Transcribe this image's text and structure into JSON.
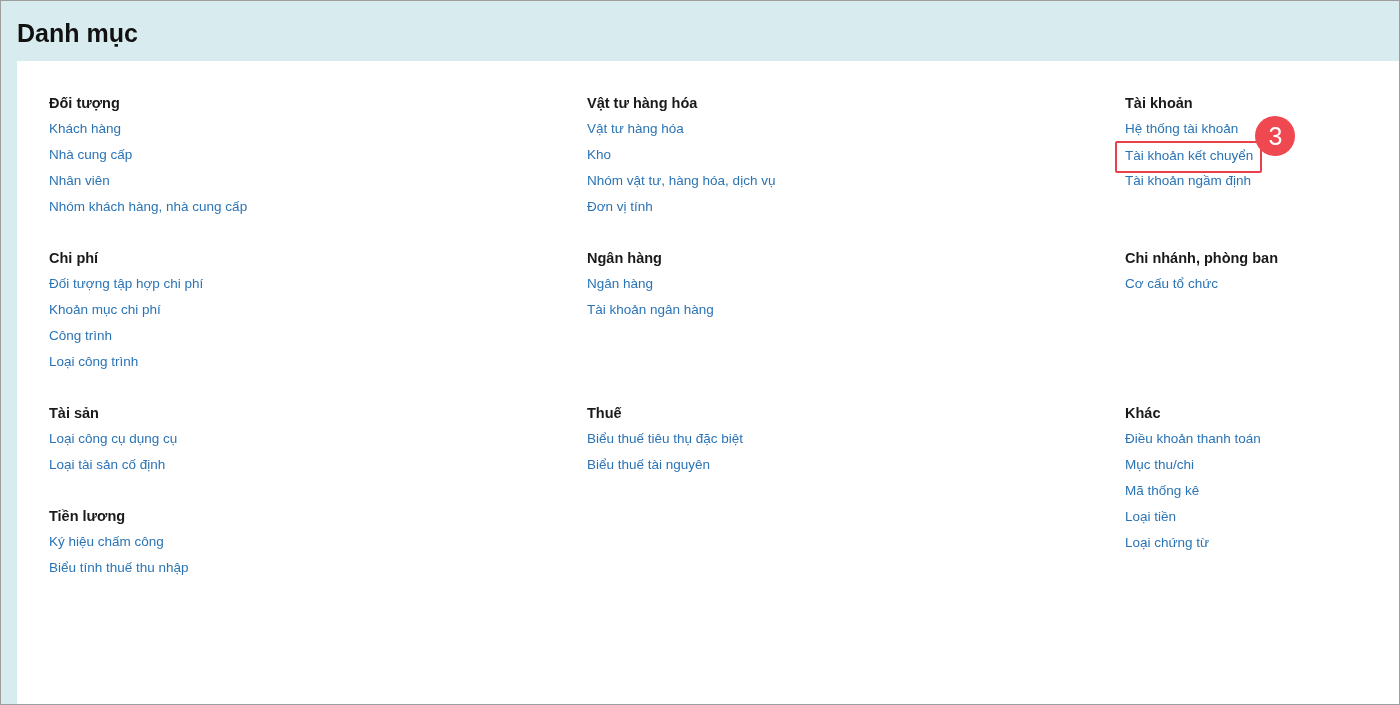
{
  "page": {
    "title": "Danh mục"
  },
  "rows": [
    {
      "columns": [
        [
          {
            "heading": "Đối tượng",
            "links": [
              {
                "label": "Khách hàng"
              },
              {
                "label": "Nhà cung cấp"
              },
              {
                "label": "Nhân viên"
              },
              {
                "label": "Nhóm khách hàng, nhà cung cấp"
              }
            ]
          }
        ],
        [
          {
            "heading": "Vật tư hàng hóa",
            "links": [
              {
                "label": "Vật tư hàng hóa"
              },
              {
                "label": "Kho"
              },
              {
                "label": "Nhóm vật tư, hàng hóa, dịch vụ"
              },
              {
                "label": "Đơn vị tính"
              }
            ]
          }
        ],
        [
          {
            "heading": "Tài khoản",
            "links": [
              {
                "label": "Hệ thống tài khoản"
              },
              {
                "label": "Tài khoản kết chuyển",
                "callout": "3"
              },
              {
                "label": "Tài khoản ngầm định"
              }
            ]
          }
        ]
      ]
    },
    {
      "columns": [
        [
          {
            "heading": "Chi phí",
            "links": [
              {
                "label": "Đối tượng tập hợp chi phí"
              },
              {
                "label": "Khoản mục chi phí"
              },
              {
                "label": "Công trình"
              },
              {
                "label": "Loại công trình"
              }
            ]
          }
        ],
        [
          {
            "heading": "Ngân hàng",
            "links": [
              {
                "label": "Ngân hàng"
              },
              {
                "label": "Tài khoản ngân hàng"
              }
            ]
          }
        ],
        [
          {
            "heading": "Chi nhánh, phòng ban",
            "links": [
              {
                "label": "Cơ cấu tổ chức"
              }
            ]
          }
        ]
      ]
    },
    {
      "columns": [
        [
          {
            "heading": "Tài sản",
            "links": [
              {
                "label": "Loại công cụ dụng cụ"
              },
              {
                "label": "Loại tài sản cố định"
              }
            ]
          },
          {
            "heading": "Tiền lương",
            "links": [
              {
                "label": "Ký hiệu chấm công"
              },
              {
                "label": "Biểu tính thuế thu nhập"
              }
            ]
          }
        ],
        [
          {
            "heading": "Thuế",
            "links": [
              {
                "label": "Biểu thuế tiêu thụ đặc biệt"
              },
              {
                "label": "Biểu thuế tài nguyên"
              }
            ]
          }
        ],
        [
          {
            "heading": "Khác",
            "links": [
              {
                "label": "Điều khoản thanh toán"
              },
              {
                "label": "Mục thu/chi"
              },
              {
                "label": "Mã thống kê"
              },
              {
                "label": "Loại tiền"
              },
              {
                "label": "Loại chứng từ"
              }
            ]
          }
        ]
      ]
    }
  ]
}
